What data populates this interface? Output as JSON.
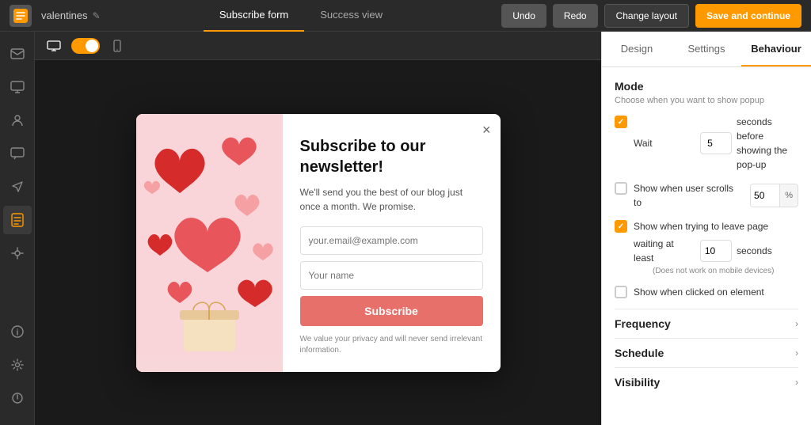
{
  "topbar": {
    "project_name": "valentines",
    "tab_subscribe": "Subscribe form",
    "tab_success": "Success view",
    "btn_undo": "Undo",
    "btn_redo": "Redo",
    "btn_change_layout": "Change layout",
    "btn_save": "Save and continue"
  },
  "sidebar": {
    "icons": [
      {
        "name": "email-icon",
        "symbol": "✉",
        "active": false
      },
      {
        "name": "monitor-icon",
        "symbol": "🖥",
        "active": false
      },
      {
        "name": "contacts-icon",
        "symbol": "👥",
        "active": false
      },
      {
        "name": "chat-icon",
        "symbol": "💬",
        "active": false
      },
      {
        "name": "send-icon",
        "symbol": "➤",
        "active": false
      },
      {
        "name": "forms-icon",
        "symbol": "📋",
        "active": true
      },
      {
        "name": "plugin-icon",
        "symbol": "⚡",
        "active": false
      }
    ],
    "bottom_icons": [
      {
        "name": "info-icon",
        "symbol": "ⓘ"
      },
      {
        "name": "settings-icon",
        "symbol": "⚙"
      },
      {
        "name": "power-icon",
        "symbol": "⏻"
      }
    ]
  },
  "canvas": {
    "toggle_on": true,
    "device_desktop_active": true
  },
  "popup": {
    "title": "Subscribe to our newsletter!",
    "description": "We'll send you the best of our blog just once a month. We promise.",
    "email_placeholder": "your.email@example.com",
    "name_placeholder": "Your name",
    "btn_label": "Subscribe",
    "privacy_text": "We value your privacy and will never send irrelevant information.",
    "close_symbol": "×"
  },
  "right_panel": {
    "tab_design": "Design",
    "tab_settings": "Settings",
    "tab_behaviour": "Behaviour",
    "mode_title": "Mode",
    "mode_subtitle": "Choose when you want to show popup",
    "wait_label": "Wait",
    "wait_value": "5",
    "wait_suffix": "seconds before showing the pop-up",
    "scroll_label": "Show when user scrolls to",
    "scroll_value": "50",
    "scroll_pct": "%",
    "leave_label": "Show when trying to leave page",
    "waiting_least_label": "waiting at least",
    "waiting_least_value": "10",
    "seconds_label": "seconds",
    "no_mobile_note": "(Does not work on mobile devices)",
    "click_label": "Show when clicked on element",
    "frequency_title": "Frequency",
    "schedule_title": "Schedule",
    "visibility_title": "Visibility"
  }
}
